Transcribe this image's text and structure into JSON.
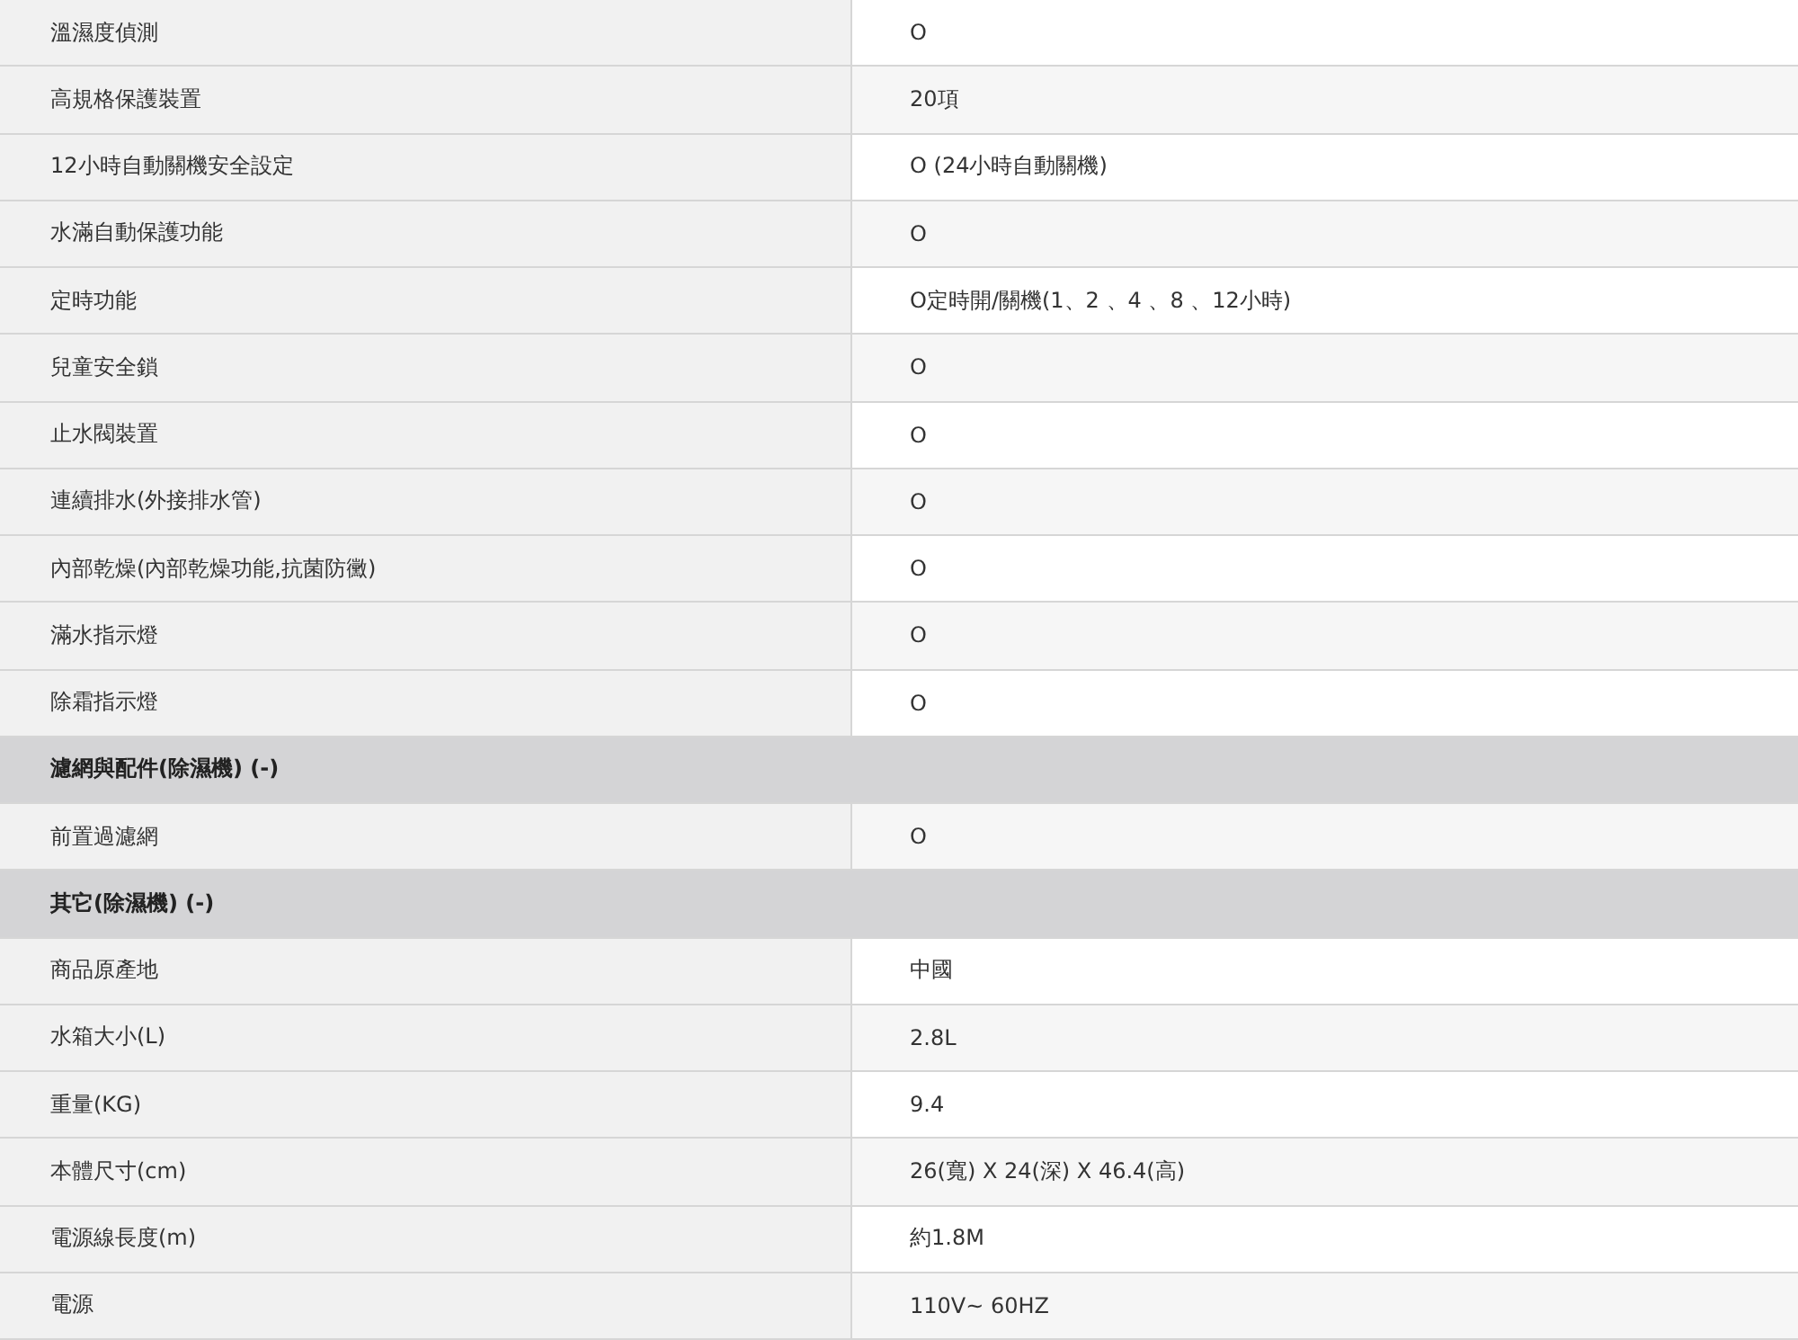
{
  "rows": [
    {
      "kind": "spec",
      "label": "溫濕度偵測",
      "value": "O"
    },
    {
      "kind": "spec",
      "label": "高規格保護裝置",
      "value": "20項"
    },
    {
      "kind": "spec",
      "label": "12小時自動關機安全設定",
      "value": "O (24小時自動關機)"
    },
    {
      "kind": "spec",
      "label": "水滿自動保護功能",
      "value": "O"
    },
    {
      "kind": "spec",
      "label": "定時功能",
      "value": "O定時開/關機(1、2 、4 、8 、12小時)"
    },
    {
      "kind": "spec",
      "label": "兒童安全鎖",
      "value": "O"
    },
    {
      "kind": "spec",
      "label": "止水閥裝置",
      "value": "O"
    },
    {
      "kind": "spec",
      "label": "連續排水(外接排水管)",
      "value": "O"
    },
    {
      "kind": "spec",
      "label": "內部乾燥(內部乾燥功能,抗菌防黴)",
      "value": "O"
    },
    {
      "kind": "spec",
      "label": "滿水指示燈",
      "value": "O"
    },
    {
      "kind": "spec",
      "label": "除霜指示燈",
      "value": "O"
    },
    {
      "kind": "section",
      "label": "濾網與配件(除濕機) (-)"
    },
    {
      "kind": "spec",
      "label": "前置過濾網",
      "value": "O"
    },
    {
      "kind": "section",
      "label": "其它(除濕機) (-)"
    },
    {
      "kind": "spec",
      "label": "商品原產地",
      "value": "中國"
    },
    {
      "kind": "spec",
      "label": "水箱大小(L)",
      "value": "2.8L"
    },
    {
      "kind": "spec",
      "label": "重量(KG)",
      "value": "9.4"
    },
    {
      "kind": "spec",
      "label": "本體尺寸(cm)",
      "value": "26(寬) X 24(深) X 46.4(高)"
    },
    {
      "kind": "spec",
      "label": "電源線長度(m)",
      "value": "約1.8M"
    },
    {
      "kind": "spec",
      "label": "電源",
      "value": "110V~ 60HZ"
    }
  ]
}
